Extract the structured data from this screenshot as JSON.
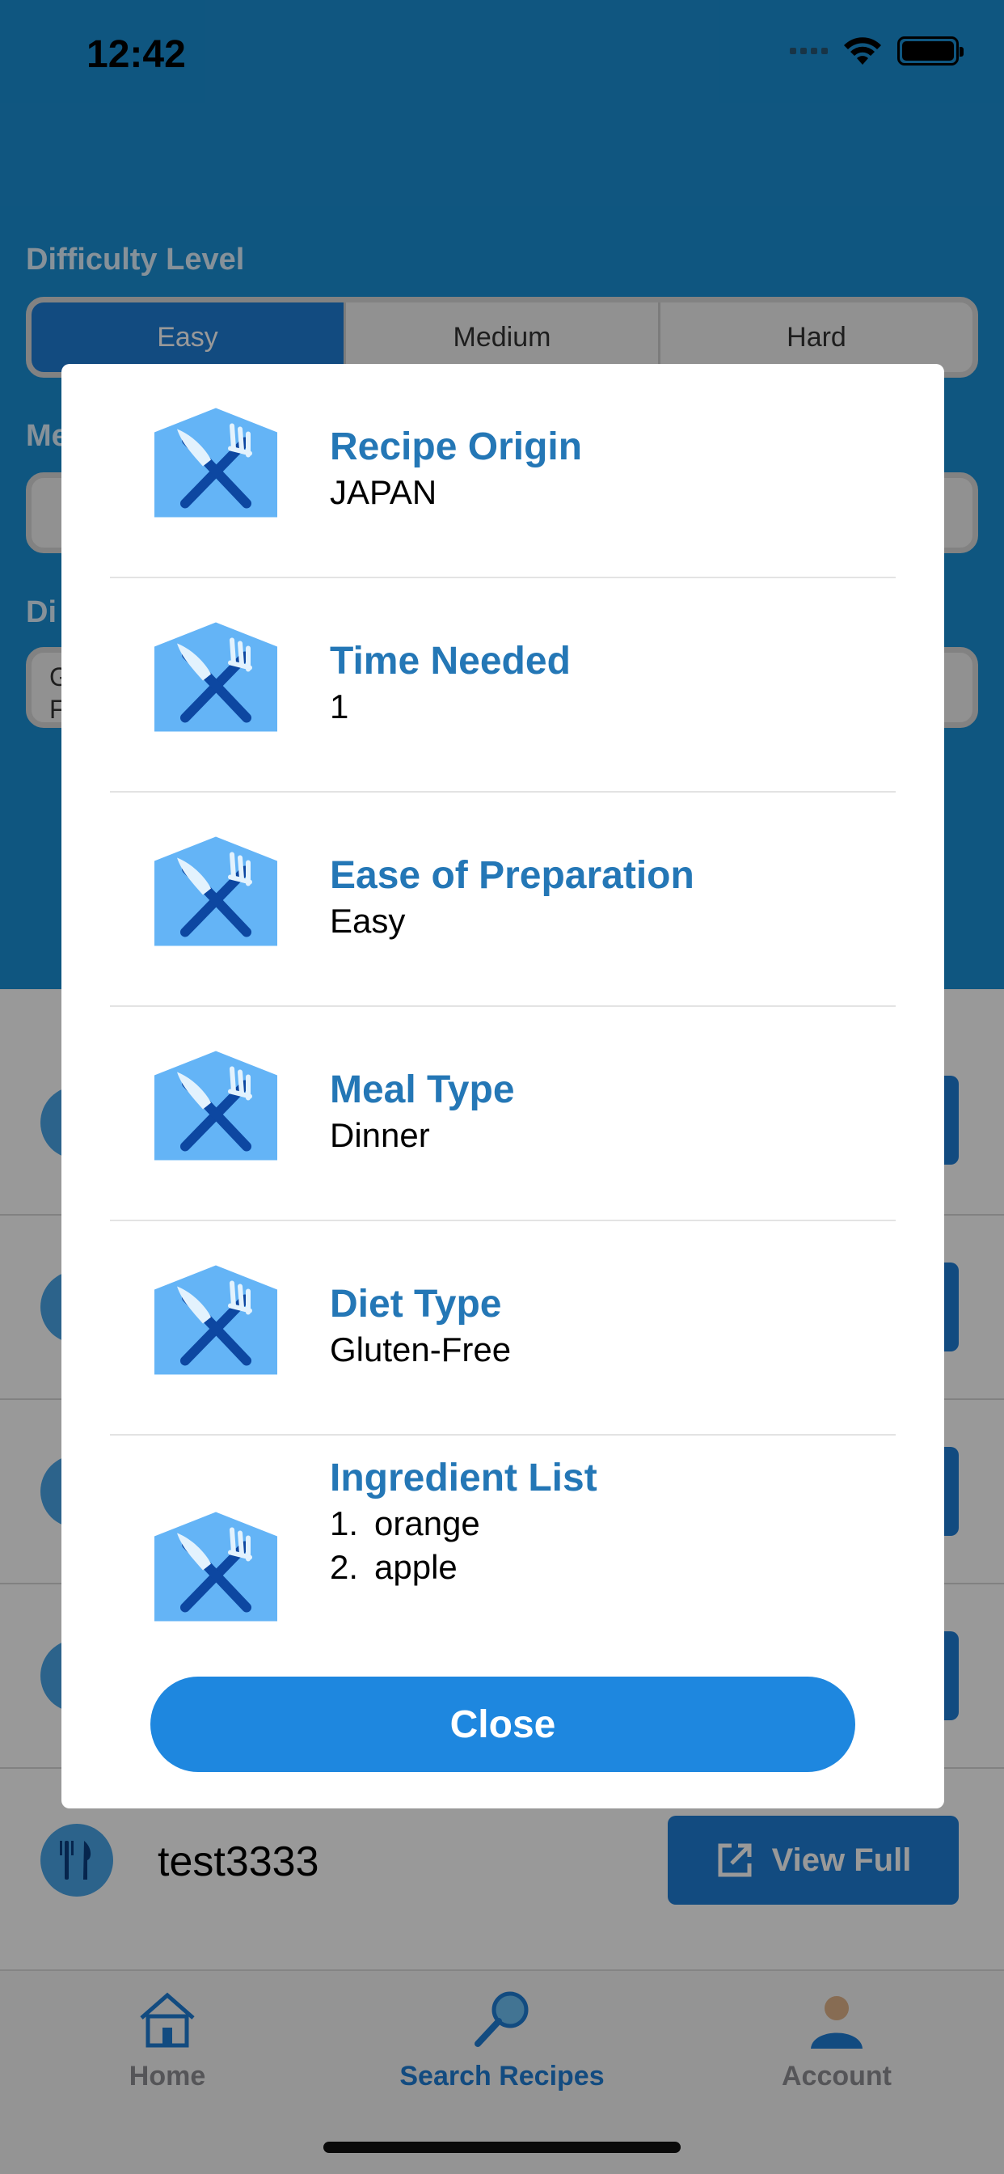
{
  "status": {
    "time": "12:42"
  },
  "filters": {
    "difficulty_label": "Difficulty Level",
    "difficulty_options": [
      "Easy",
      "Medium",
      "Hard"
    ],
    "meal_label_partial": "Me",
    "diet_label_partial": "Di",
    "diet_field_partial": "G\nF"
  },
  "background_list": {
    "last_item": "test3333",
    "view_full_label": "View Full"
  },
  "modal": {
    "rows": [
      {
        "title": "Recipe Origin",
        "value": "JAPAN"
      },
      {
        "title": "Time Needed",
        "value": "1"
      },
      {
        "title": "Ease of Preparation",
        "value": "Easy"
      },
      {
        "title": "Meal Type",
        "value": "Dinner"
      },
      {
        "title": "Diet Type",
        "value": "Gluten-Free"
      }
    ],
    "ingredients": {
      "title": "Ingredient List",
      "items": [
        {
          "num": "1.",
          "name": "orange"
        },
        {
          "num": "2.",
          "name": "apple"
        }
      ]
    },
    "close_label": "Close"
  },
  "tabs": [
    {
      "label": "Home",
      "icon": "house-icon"
    },
    {
      "label": "Search Recipes",
      "icon": "magnifier-icon"
    },
    {
      "label": "Account",
      "icon": "person-icon"
    }
  ],
  "colors": {
    "header_blue": "#1a8fd6",
    "accent": "#1f7dd6",
    "title_blue": "#2477b6",
    "close_button": "#1e87df"
  }
}
